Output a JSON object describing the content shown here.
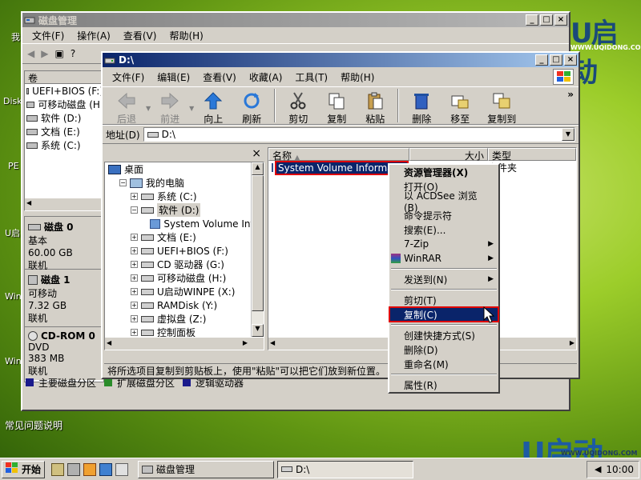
{
  "desktop": {
    "labels": [
      "我",
      "Disk",
      "PE",
      "U启",
      "Win",
      "Win"
    ],
    "faq": "常见问题说明",
    "brand_top": "U启动",
    "brand_top_url": "WWW.UQIDONG.COM",
    "brand_bottom": "U启动",
    "brand_bottom_url": "WWW.UQIDONG.COM"
  },
  "disk_mgmt": {
    "title": "磁盘管理",
    "menu": [
      "文件(F)",
      "操作(A)",
      "查看(V)",
      "帮助(H)"
    ],
    "volume_header": "卷",
    "volumes": [
      "UEFI+BIOS (F:)",
      "可移动磁盘 (H:",
      "软件 (D:)",
      "文档 (E:)",
      "系统 (C:)"
    ],
    "disks": [
      {
        "name": "磁盘 0",
        "type": "基本",
        "size": "60.00 GB",
        "status": "联机"
      },
      {
        "name": "磁盘 1",
        "type": "可移动",
        "size": "7.32 GB",
        "status": "联机"
      },
      {
        "name": "CD-ROM 0",
        "type": "DVD",
        "size": "383 MB",
        "status": "联机"
      }
    ],
    "legend": [
      "主要磁盘分区",
      "扩展磁盘分区",
      "逻辑驱动器"
    ]
  },
  "explorer": {
    "title": "D:\\",
    "menu": [
      "文件(F)",
      "编辑(E)",
      "查看(V)",
      "收藏(A)",
      "工具(T)",
      "帮助(H)"
    ],
    "toolbar": {
      "back": "后退",
      "forward": "前进",
      "up": "向上",
      "refresh": "刷新",
      "cut": "剪切",
      "copy": "复制",
      "paste": "粘贴",
      "delete": "删除",
      "move_to": "移至",
      "copy_to": "复制到",
      "more": "»"
    },
    "address_label": "地址(D)",
    "address_value": "D:\\",
    "tree_close": "×",
    "tree": [
      {
        "label": "桌面",
        "level": 0
      },
      {
        "label": "我的电脑",
        "level": 1,
        "exp": "−"
      },
      {
        "label": "系统 (C:)",
        "level": 2,
        "exp": "+"
      },
      {
        "label": "软件 (D:)",
        "level": 2,
        "exp": "−",
        "selected": true
      },
      {
        "label": "System Volume Infor",
        "level": 3
      },
      {
        "label": "文档 (E:)",
        "level": 2,
        "exp": "+"
      },
      {
        "label": "UEFI+BIOS (F:)",
        "level": 2,
        "exp": "+"
      },
      {
        "label": "CD 驱动器 (G:)",
        "level": 2,
        "exp": "+"
      },
      {
        "label": "可移动磁盘 (H:)",
        "level": 2,
        "exp": "+"
      },
      {
        "label": "U启动WINPE (X:)",
        "level": 2,
        "exp": "+"
      },
      {
        "label": "RAMDisk (Y:)",
        "level": 2,
        "exp": "+"
      },
      {
        "label": "虚拟盘 (Z:)",
        "level": 2,
        "exp": "+"
      },
      {
        "label": "控制面板",
        "level": 2,
        "exp": "+"
      }
    ],
    "columns": {
      "name": "名称",
      "size": "大小",
      "type": "类型"
    },
    "files": [
      {
        "name": "System Volume Informatio",
        "type": "文件夹"
      }
    ],
    "status": "将所选项目复制到剪贴板上，使用\"粘贴\"可以把它们放到新位置。"
  },
  "context_menu": {
    "items": [
      {
        "label": "资源管理器(X)",
        "bold": true
      },
      {
        "label": "打开(O)"
      },
      {
        "label": "以 ACDSee 浏览(B)"
      },
      {
        "label": "命令提示符"
      },
      {
        "label": "搜索(E)..."
      },
      {
        "label": "7-Zip",
        "submenu": true
      },
      {
        "label": "WinRAR",
        "submenu": true,
        "icon": true
      },
      {
        "sep": true
      },
      {
        "label": "发送到(N)",
        "submenu": true
      },
      {
        "sep": true
      },
      {
        "label": "剪切(T)"
      },
      {
        "label": "复制(C)",
        "highlight": true
      },
      {
        "sep": true
      },
      {
        "label": "创建快捷方式(S)"
      },
      {
        "label": "删除(D)"
      },
      {
        "label": "重命名(M)"
      },
      {
        "sep": true
      },
      {
        "label": "属性(R)"
      }
    ]
  },
  "taskbar": {
    "start": "开始",
    "tasks": [
      "磁盘管理",
      "D:\\"
    ],
    "clock": "10:00"
  },
  "colors": {
    "highlight": "#0a246a",
    "annotation": "#e00000"
  }
}
